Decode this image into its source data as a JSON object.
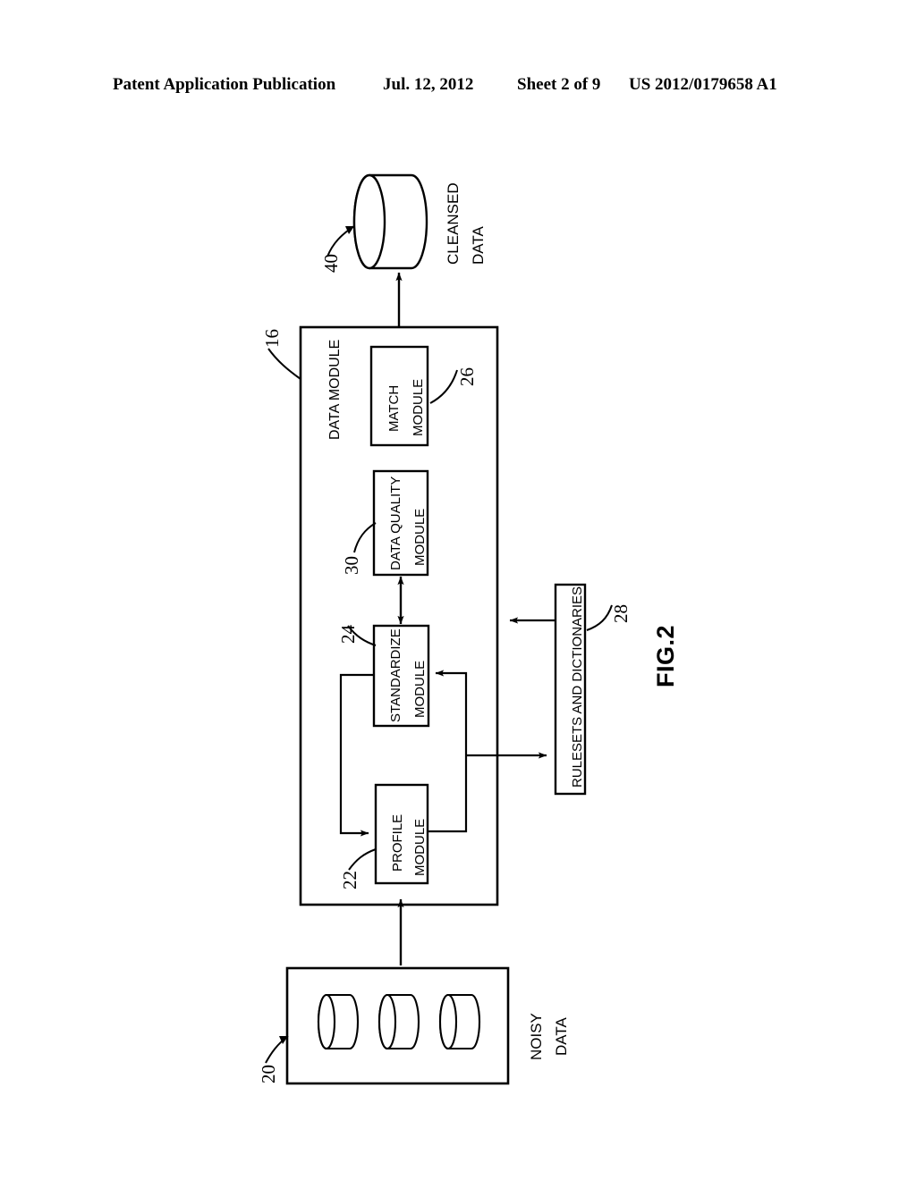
{
  "header": {
    "publication": "Patent Application Publication",
    "date": "Jul. 12, 2012",
    "sheet": "Sheet 2 of 9",
    "number": "US 2012/0179658 A1"
  },
  "figure": {
    "caption": "FIG.2",
    "datastore_cleansed": {
      "label_line1": "CLEANSED",
      "label_line2": "DATA",
      "ref": "40"
    },
    "datastore_noisy": {
      "label_line1": "NOISY",
      "label_line2": "DATA",
      "ref": "20",
      "cylinder_count": 3
    },
    "data_module": {
      "label": "DATA MODULE",
      "ref": "16"
    },
    "modules": [
      {
        "name": "match",
        "label_line1": "MATCH",
        "label_line2": "MODULE",
        "ref": "26"
      },
      {
        "name": "data-quality",
        "label_line1": "DATA QUALITY",
        "label_line2": "MODULE",
        "ref": "30"
      },
      {
        "name": "standardize",
        "label_line1": "STANDARDIZE",
        "label_line2": "MODULE",
        "ref": "24"
      },
      {
        "name": "profile",
        "label_line1": "PROFILE",
        "label_line2": "MODULE",
        "ref": "22"
      }
    ],
    "rulesets": {
      "label": "RULESETS AND DICTIONARIES",
      "ref": "28"
    },
    "colors": {
      "stroke": "#000000",
      "background": "#ffffff"
    }
  }
}
